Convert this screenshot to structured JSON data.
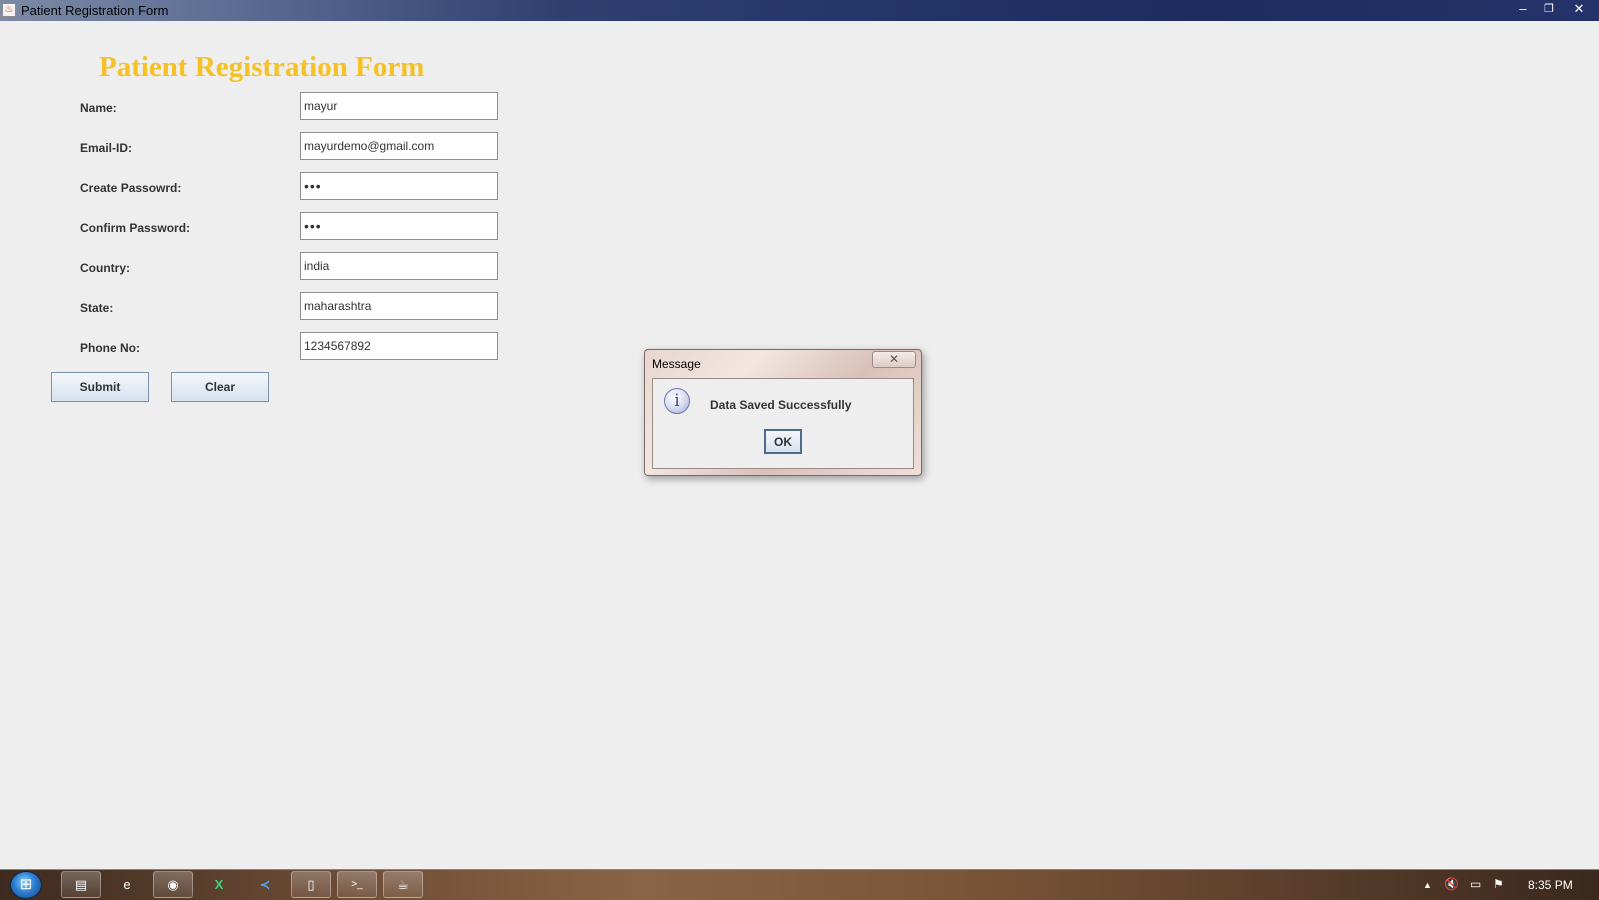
{
  "window": {
    "title": "Patient Registration Form",
    "minimize_glyph": "–",
    "restore_glyph": "❐",
    "close_glyph": "✕",
    "app_icon": "java-icon"
  },
  "form": {
    "heading": "Patient Registration Form",
    "heading_color": "#f5c126",
    "fields": {
      "name": {
        "label": "Name:",
        "value": "mayur"
      },
      "email": {
        "label": "Email-ID:",
        "value": "mayurdemo@gmail.com"
      },
      "create_password": {
        "label": "Create Passowrd:",
        "value": "•••"
      },
      "confirm_password": {
        "label": "Confirm Password:",
        "value": "•••"
      },
      "country": {
        "label": "Country:",
        "value": "india"
      },
      "state": {
        "label": "State:",
        "value": "maharashtra"
      },
      "phone": {
        "label": "Phone No:",
        "value": "1234567892"
      }
    },
    "submit_label": "Submit",
    "clear_label": "Clear"
  },
  "dialog": {
    "title": "Message",
    "close_glyph": "✕",
    "icon": "info-icon",
    "icon_glyph": "i",
    "message": "Data Saved Successfully",
    "ok_label": "OK"
  },
  "taskbar": {
    "start_glyph": "⊞",
    "items": [
      {
        "name": "file-explorer-icon",
        "glyph": "▤"
      },
      {
        "name": "edge-icon",
        "glyph": "e"
      },
      {
        "name": "chrome-icon",
        "glyph": "◉"
      },
      {
        "name": "excel-icon",
        "glyph": "X"
      },
      {
        "name": "vscode-icon",
        "glyph": "≺"
      },
      {
        "name": "notepad-icon",
        "glyph": "▯"
      },
      {
        "name": "cmd-icon",
        "glyph": ">_"
      },
      {
        "name": "java-app-icon",
        "glyph": "☕"
      }
    ],
    "tray": {
      "show_hidden_glyph": "▲",
      "volume_glyph": "🔇",
      "network_glyph": "▭",
      "flag_glyph": "⚑"
    },
    "clock": "8:35 PM"
  }
}
